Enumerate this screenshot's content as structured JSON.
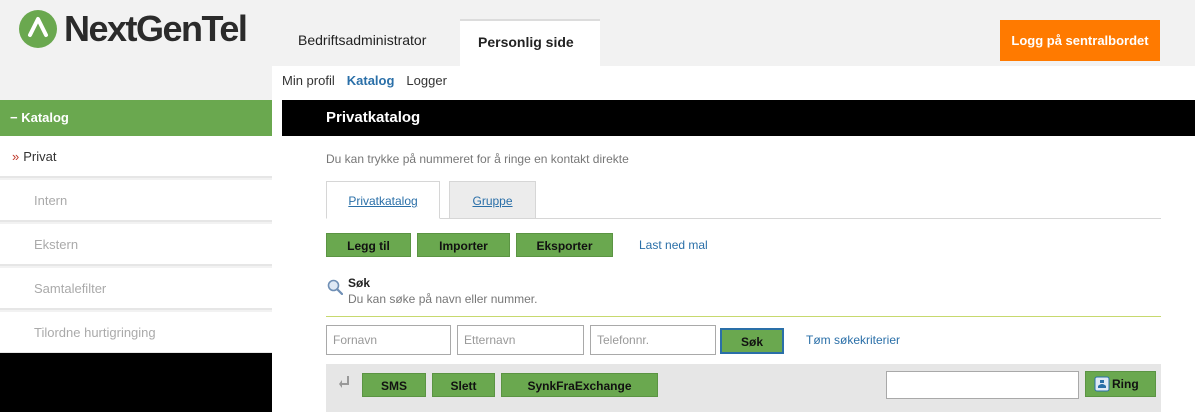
{
  "brand": {
    "name": "NextGenTel",
    "accent": "#6aa84f",
    "orange": "#ff7a00"
  },
  "header": {
    "tabs": [
      {
        "label": "Bedriftsadministrator"
      },
      {
        "label": "Personlig side"
      }
    ],
    "login_label": "Logg på sentralbordet"
  },
  "subnav": [
    "Min profil",
    "Katalog",
    "Logger"
  ],
  "sidebar": {
    "title": "− Katalog",
    "items": [
      {
        "label": "Privat",
        "active": true
      },
      {
        "label": "Intern"
      },
      {
        "label": "Ekstern"
      },
      {
        "label": "Samtalefilter"
      },
      {
        "label": "Tilordne hurtigringing"
      }
    ]
  },
  "main": {
    "title": "Privatkatalog",
    "hint": "Du kan trykke på nummeret for å ringe en kontakt direkte",
    "tabs": [
      "Privatkatalog",
      "Gruppe"
    ],
    "actions": [
      "Legg til",
      "Importer",
      "Eksporter"
    ],
    "template_link": "Last ned mal",
    "search": {
      "title": "Søk",
      "subtitle": "Du kan søke på navn eller nummer.",
      "placeholders": [
        "Fornavn",
        "Etternavn",
        "Telefonnr."
      ],
      "button": "Søk",
      "clear": "Tøm søkekriterier"
    },
    "toolbar": {
      "buttons": [
        "SMS",
        "Slett",
        "SynkFraExchange"
      ],
      "ring": "Ring"
    }
  }
}
